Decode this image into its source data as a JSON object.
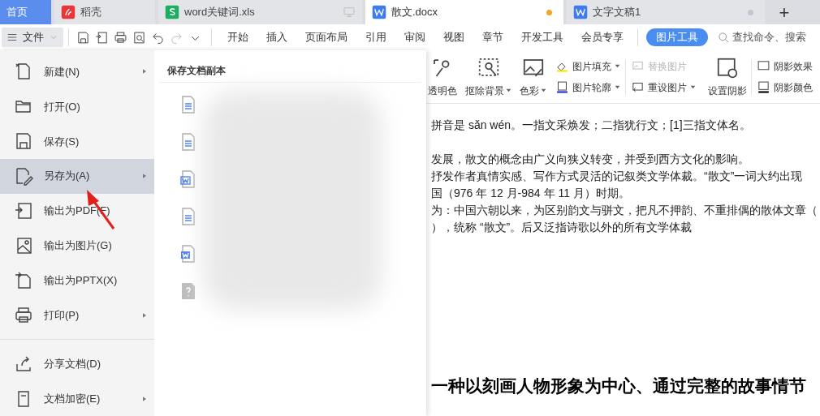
{
  "tabs": [
    {
      "kind": "home",
      "label": "首页",
      "selected": false
    },
    {
      "kind": "docer",
      "label": "稻壳",
      "selected": false
    },
    {
      "kind": "sheet",
      "label": "word关键词.xls",
      "selected": false,
      "monitor": true
    },
    {
      "kind": "writer",
      "label": "散文.docx",
      "selected": true,
      "unsaved": true
    },
    {
      "kind": "writer",
      "label": "文字文稿1",
      "selected": false,
      "unsaved": false
    }
  ],
  "new_tab": "+",
  "file_menu_button": "文件",
  "ribbon_tabs": [
    {
      "label": "开始",
      "selected": false
    },
    {
      "label": "插入",
      "selected": false
    },
    {
      "label": "页面布局",
      "selected": false
    },
    {
      "label": "引用",
      "selected": false
    },
    {
      "label": "审阅",
      "selected": false
    },
    {
      "label": "视图",
      "selected": false
    },
    {
      "label": "章节",
      "selected": false
    },
    {
      "label": "开发工具",
      "selected": false
    },
    {
      "label": "会员专享",
      "selected": false
    },
    {
      "label": "图片工具",
      "selected": true
    }
  ],
  "search": {
    "placeholder": "查找命令、搜索"
  },
  "ribbon_tools": [
    {
      "kind": "big",
      "label": "透明色",
      "dropdown": false
    },
    {
      "kind": "big",
      "label": "抠除背景",
      "dropdown": true
    },
    {
      "kind": "big",
      "label": "色彩",
      "dropdown": true
    },
    {
      "kind": "pair",
      "items": [
        {
          "label": "图片填充",
          "dropdown": true,
          "disabled": false
        },
        {
          "label": "图片轮廓",
          "dropdown": true,
          "disabled": false
        }
      ]
    },
    {
      "kind": "pair",
      "items": [
        {
          "label": "替换图片",
          "dropdown": false,
          "disabled": true
        },
        {
          "label": "重设图片",
          "dropdown": true,
          "disabled": false
        }
      ]
    },
    {
      "kind": "big",
      "label": "设置阴影",
      "dropdown": false
    },
    {
      "kind": "pair",
      "items": [
        {
          "label": "阴影效果",
          "dropdown": false,
          "disabled": false
        },
        {
          "label": "阴影颜色",
          "dropdown": false,
          "disabled": false
        }
      ]
    }
  ],
  "file_menu": [
    {
      "label": "新建(N)",
      "has_submenu": true,
      "selected": false
    },
    {
      "label": "打开(O)",
      "has_submenu": false,
      "selected": false
    },
    {
      "label": "保存(S)",
      "has_submenu": false,
      "selected": false
    },
    {
      "label": "另存为(A)",
      "has_submenu": true,
      "selected": true
    },
    {
      "label": "输出为PDF(F)",
      "has_submenu": false,
      "selected": false
    },
    {
      "label": "输出为图片(G)",
      "has_submenu": false,
      "selected": false
    },
    {
      "label": "输出为PPTX(X)",
      "has_submenu": false,
      "selected": false
    },
    {
      "label": "打印(P)",
      "has_submenu": true,
      "selected": false
    },
    {
      "label": "分享文档(D)",
      "has_submenu": false,
      "selected": false,
      "separator_before": true
    },
    {
      "label": "文档加密(E)",
      "has_submenu": true,
      "selected": false
    }
  ],
  "submenu": {
    "title": "保存文档副本",
    "files": [
      {
        "kind": "text"
      },
      {
        "kind": "text"
      },
      {
        "kind": "word"
      },
      {
        "kind": "text"
      },
      {
        "kind": "word_filled"
      },
      {
        "kind": "unknown"
      }
    ]
  },
  "document": {
    "paragraphs": [
      {
        "kind": "normal",
        "text": "拼音是 sǎn wén。一指文采焕发；二指犹行文；[1]三指文体名。",
        "gap_after": true
      },
      {
        "kind": "normal",
        "text": "发展，散文的概念由广义向狭义转变，并受到西方文化的影响。"
      },
      {
        "kind": "normal",
        "text": "抒发作者真情实感、写作方式灵活的记叙类文学体裁。“散文”一词大约出现"
      },
      {
        "kind": "normal",
        "text": "国（976 年 12 月-984 年 11 月）时期。"
      },
      {
        "kind": "normal",
        "text": "为：中国六朝以来，为区别韵文与骈文，把凡不押韵、不重排偶的散体文章（"
      },
      {
        "kind": "normal",
        "text": "），统称 “散文”。后又泛指诗歌以外的所有文学体裁"
      },
      {
        "kind": "heading",
        "text": "一种以刻画人物形象为中心、通过完整的故事情节"
      }
    ]
  }
}
